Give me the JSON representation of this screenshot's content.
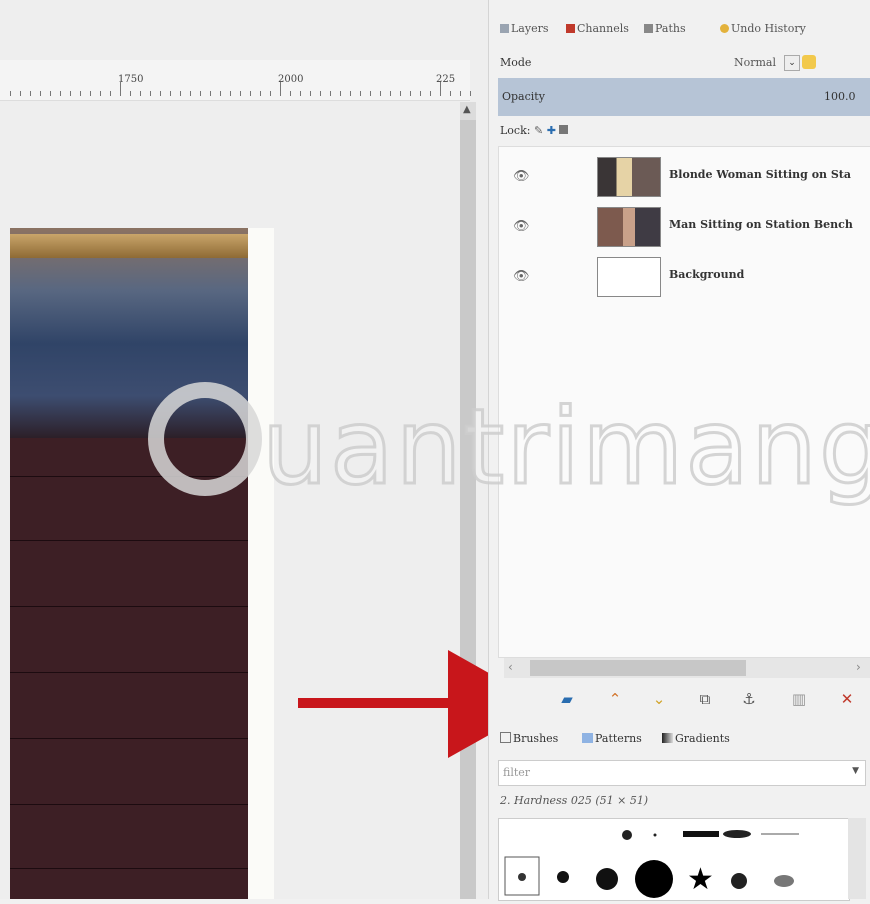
{
  "canvas": {
    "ruler_labels": [
      "1750",
      "2000",
      "225"
    ]
  },
  "panel": {
    "tabs": [
      {
        "label": "Layers",
        "color": "#9aa4b1"
      },
      {
        "label": "Channels",
        "color": "#c0392b"
      },
      {
        "label": "Paths",
        "color": "#888888"
      },
      {
        "label": "Undo History",
        "color": "#e3b23c"
      }
    ],
    "mode_label": "Mode",
    "mode_value": "Normal",
    "opacity_label": "Opacity",
    "opacity_value": "100.0",
    "lock_label": "Lock:",
    "layers": [
      {
        "name": "Blonde Woman Sitting on Sta",
        "thumb": "#6b5a55"
      },
      {
        "name": "Man Sitting on Station Bench",
        "thumb": "#5a4e4e"
      },
      {
        "name": "Background",
        "thumb": "#ffffff"
      }
    ],
    "buttons": [
      {
        "icon": "new-layer-group-icon",
        "glyph": "🖿",
        "color": "#2a6db0"
      },
      {
        "icon": "raise-layer-icon",
        "glyph": "^",
        "color": "#d2742a"
      },
      {
        "icon": "lower-layer-icon",
        "glyph": "v",
        "color": "#d2a42a"
      },
      {
        "icon": "duplicate-layer-icon",
        "glyph": "⧉",
        "color": "#555555"
      },
      {
        "icon": "anchor-layer-icon",
        "glyph": "⚓",
        "color": "#555555"
      },
      {
        "icon": "mask-icon",
        "glyph": "▥",
        "color": "#999999"
      },
      {
        "icon": "delete-layer-icon",
        "glyph": "✕",
        "color": "#c0392b"
      }
    ],
    "brush_tabs": [
      {
        "label": "Brushes"
      },
      {
        "label": "Patterns"
      },
      {
        "label": "Gradients"
      }
    ],
    "filter_placeholder": "filter",
    "brush_name": "2. Hardness 025 (51 × 51)"
  },
  "watermark": {
    "text": "uantrimang"
  },
  "colors": {
    "arrow": "#c8161b",
    "opacity_bar": "#b6c4d6"
  }
}
